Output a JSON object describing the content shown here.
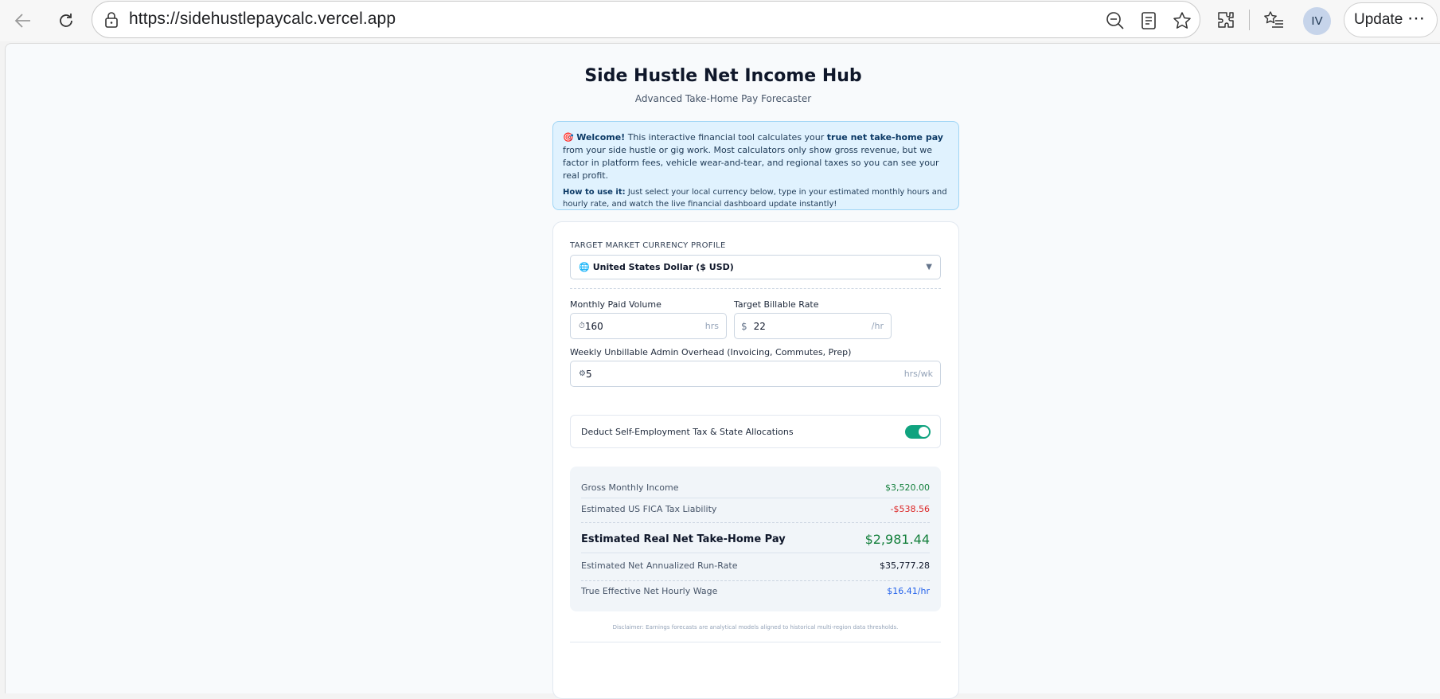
{
  "browser": {
    "url": "https://sidehustlepaycalc.vercel.app",
    "profile_initials": "IV",
    "update_label": "Update",
    "more_glyph": "⋯"
  },
  "header": {
    "title": "Side Hustle Net Income Hub",
    "subtitle": "Advanced Take-Home Pay Forecaster"
  },
  "welcome": {
    "icon": "🎯",
    "heading": "Welcome!",
    "text_1": " This interactive financial tool calculates your ",
    "bold_1": "true net take-home pay",
    "text_2": " from your side hustle or gig work. Most calculators only show gross revenue, but we factor in platform fees, vehicle wear-and-tear, and regional taxes so you can see your real profit.",
    "howto_heading": "How to use it:",
    "howto_text": " Just select your local currency below, type in your estimated monthly hours and hourly rate, and watch the live financial dashboard update instantly!"
  },
  "form": {
    "currency_label": "TARGET MARKET CURRENCY PROFILE",
    "currency_icon": "🌐",
    "currency_value": "United States Dollar ($ USD)",
    "volume_label": "Monthly Paid Volume",
    "volume_icon": "⏱",
    "volume_value": "160",
    "volume_suffix": "hrs",
    "rate_label": "Target Billable Rate",
    "rate_prefix": "$",
    "rate_value": "22",
    "rate_suffix": "/hr",
    "overhead_label": "Weekly Unbillable Admin Overhead (Invoicing, Commutes, Prep)",
    "overhead_icon": "⚙",
    "overhead_value": "5",
    "overhead_suffix": "hrs/wk",
    "toggle_label": "Deduct Self-Employment Tax & State Allocations",
    "toggle_on": true
  },
  "results": {
    "gross_label": "Gross Monthly Income",
    "gross_value": "$3,520.00",
    "fica_label": "Estimated US FICA Tax Liability",
    "fica_value": "-$538.56",
    "net_label": "Estimated Real Net Take-Home Pay",
    "net_value": "$2,981.44",
    "annual_label": "Estimated Net Annualized Run-Rate",
    "annual_value": "$35,777.28",
    "hourly_label": "True Effective Net Hourly Wage",
    "hourly_value": "$16.41/hr"
  },
  "disclaimer": "Disclaimer: Earnings forecasts are analytical models aligned to historical multi-region data thresholds."
}
